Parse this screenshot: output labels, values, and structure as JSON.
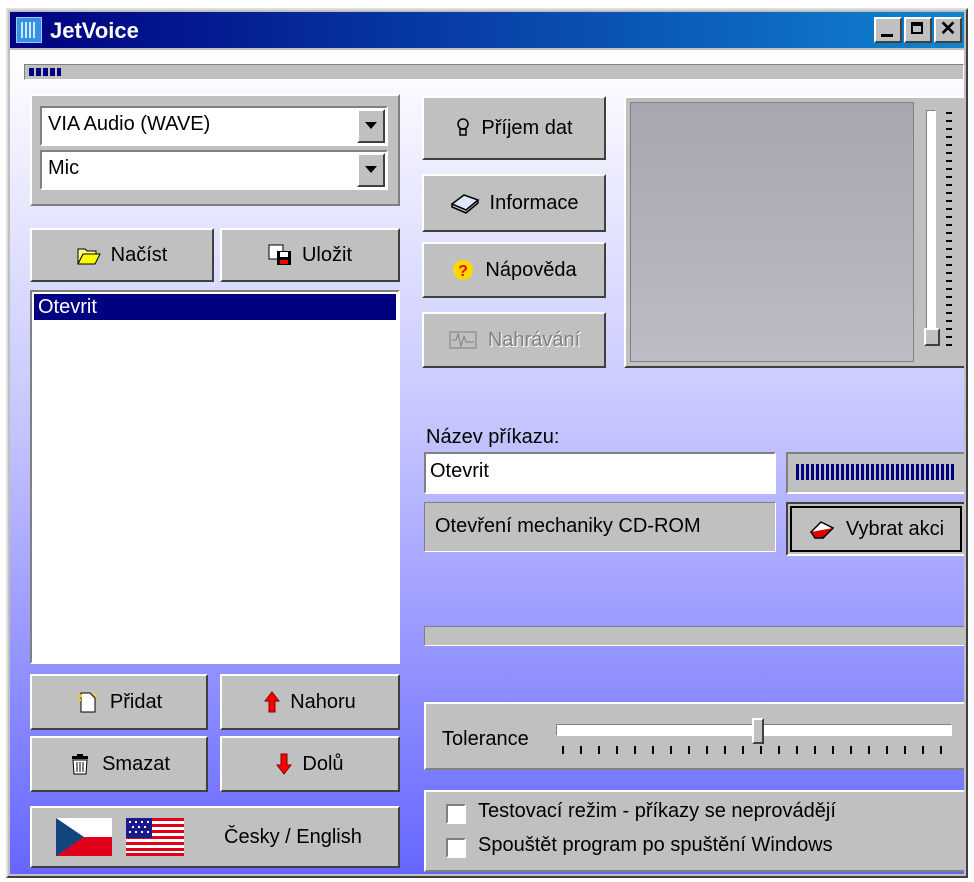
{
  "window": {
    "title": "JetVoice"
  },
  "progress_top": {
    "value": 0.04
  },
  "audio": {
    "device": "VIA Audio (WAVE)",
    "input": "Mic"
  },
  "file_buttons": {
    "load": "Načíst",
    "save": "Uložit"
  },
  "commands": {
    "items": [
      "Otevrit"
    ],
    "selected_index": 0
  },
  "list_buttons": {
    "add": "Přidat",
    "up": "Nahoru",
    "delete": "Smazat",
    "down": "Dolů"
  },
  "language_button": {
    "label": "Česky / English"
  },
  "actions": {
    "receive": "Příjem dat",
    "info": "Informace",
    "help": "Nápověda",
    "record": "Nahrávání"
  },
  "command_name": {
    "label": "Název příkazu:",
    "value": "Otevrit"
  },
  "action_description": "Otevření mechaniky CD-ROM",
  "select_action_button": "Vybrat akci",
  "tolerance": {
    "label": "Tolerance",
    "value": 0.51
  },
  "options": {
    "test_mode": {
      "label": "Testovací režim - příkazy se neprovádějí",
      "checked": false
    },
    "autostart": {
      "label": "Spouštět program po spuštění Windows",
      "checked": false
    }
  },
  "colors": {
    "title_start": "#000080",
    "title_end": "#1084d0",
    "selection": "#000080"
  }
}
